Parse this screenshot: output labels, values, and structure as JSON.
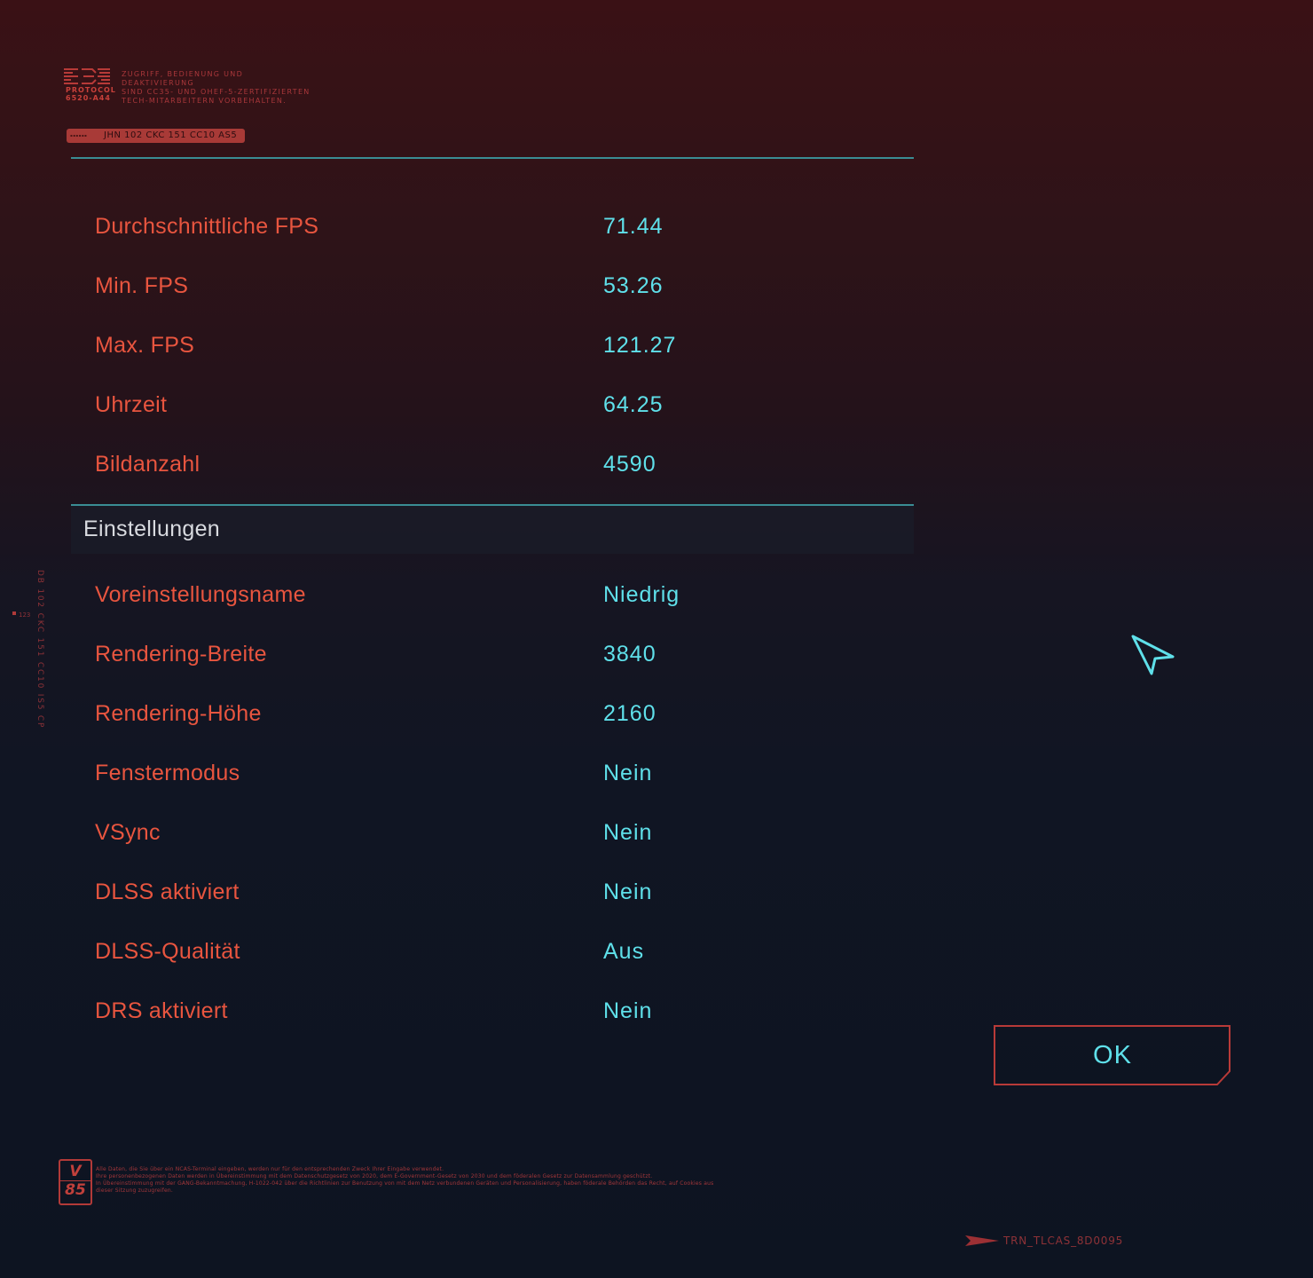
{
  "header": {
    "logo_text": "PROTOCOL 6520-A44",
    "notice_lines": [
      "ZUGRIFF, BEDIENUNG UND DEAKTIVIERUNG",
      "SIND CC35- UND OHEF-5-ZERTIFIZIERTEN",
      "TECH-MITARBEITERN VORBEHALTEN."
    ],
    "id_code": "JHN 102 CKC 151 CC10 AS5"
  },
  "stats": [
    {
      "label": "Durchschnittliche FPS",
      "value": "71.44"
    },
    {
      "label": "Min. FPS",
      "value": "53.26"
    },
    {
      "label": "Max. FPS",
      "value": "121.27"
    },
    {
      "label": "Uhrzeit",
      "value": "64.25"
    },
    {
      "label": "Bildanzahl",
      "value": "4590"
    }
  ],
  "settings_section": {
    "title": "Einstellungen",
    "items": [
      {
        "label": "Voreinstellungsname",
        "value": "Niedrig"
      },
      {
        "label": "Rendering-Breite",
        "value": "3840"
      },
      {
        "label": "Rendering-Höhe",
        "value": "2160"
      },
      {
        "label": "Fenstermodus",
        "value": "Nein"
      },
      {
        "label": "VSync",
        "value": "Nein"
      },
      {
        "label": "DLSS aktiviert",
        "value": "Nein"
      },
      {
        "label": "DLSS-Qualität",
        "value": "Aus"
      },
      {
        "label": "DRS aktiviert",
        "value": "Nein"
      }
    ]
  },
  "side": {
    "vertical_code": "DB 102 CKC 151 CC10 IS5 CP",
    "mark": "123"
  },
  "ok_button": {
    "label": "OK"
  },
  "footer": {
    "badge_top": "V",
    "badge_bottom": "85",
    "legal_lines": [
      "Alle Daten, die Sie über ein NCAS-Terminal eingeben, werden nur für den entsprechenden Zweck Ihrer Eingabe verwendet.",
      "Ihre personenbezogenen Daten werden in Übereinstimmung mit dem Datenschutzgesetz von 2020, dem E-Government-Gesetz von 2030 und dem föderalen Gesetz zur Datensammlung geschützt.",
      "In Übereinstimmung mit der GANG-Bekanntmachung, H-1022-042 über die Richtlinien zur Benutzung von mit dem Netz verbundenen Geräten und Personalisierung, haben föderale Behörden das Recht, auf Cookies aus",
      "dieser Sitzung zuzugreifen."
    ],
    "code": "TRN_TLCAS_8D0095"
  },
  "colors": {
    "accent_red": "#e8553f",
    "accent_cyan": "#5fe0ea",
    "rule_teal": "#3a8d94"
  },
  "icons": {
    "logo": "protocol-logo-icon",
    "cursor": "arrow-cursor-icon",
    "footer_arrow": "arrow-right-icon"
  }
}
